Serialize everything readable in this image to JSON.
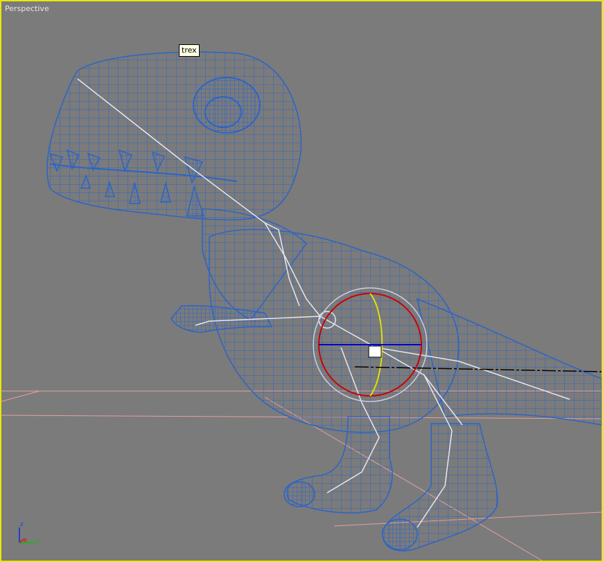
{
  "viewport": {
    "label": "Perspective",
    "border_color": "#e8e800",
    "background": "#7b7b7b"
  },
  "object": {
    "name_tooltip": "trex",
    "wire_color": "#2b64c8",
    "bone_color": "#e8e8f0"
  },
  "gizmo": {
    "x_color": "#cc0000",
    "y_color": "#e0e000",
    "z_color": "#0000cc"
  },
  "axis_tripod": {
    "x_label": "x",
    "y_label": "y",
    "z_label": "z",
    "x_color": "#d42020",
    "y_color": "#20b020",
    "z_color": "#2040d0"
  },
  "grid": {
    "color": "#e6a0a0"
  }
}
